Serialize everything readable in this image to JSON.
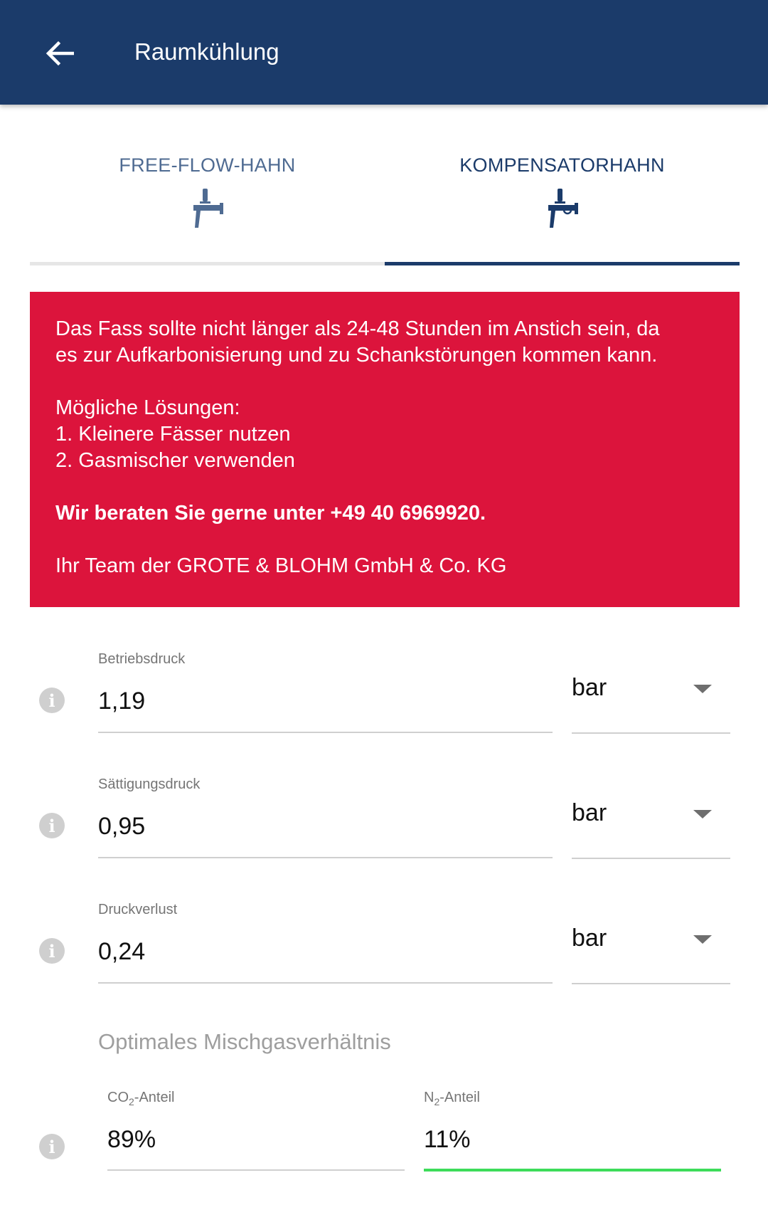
{
  "appbar": {
    "title": "Raumkühlung",
    "back_icon": "arrow-left-icon"
  },
  "tabs": [
    {
      "label": "FREE-FLOW-HAHN",
      "icon": "free-flow-tap-icon",
      "active": false
    },
    {
      "label": "KOMPENSATORHAHN",
      "icon": "compensator-tap-icon",
      "active": true
    }
  ],
  "alert": {
    "line1": "Das Fass sollte nicht länger als 24-48 Stunden im Anstich sein, da",
    "line2": "es zur Aufkarbonisierung und zu Schankstörungen kommen kann.",
    "solutions_title": "Mögliche Lösungen:",
    "solution1": "1. Kleinere Fässer nutzen",
    "solution2": "2. Gasmischer verwenden",
    "contact": "Wir beraten Sie gerne unter +49 40 6969920.",
    "signature": "Ihr Team der GROTE & BLOHM GmbH & Co. KG",
    "background_color": "#dc143c"
  },
  "fields": {
    "betriebsdruck": {
      "label": "Betriebsdruck",
      "value": "1,19",
      "unit": "bar"
    },
    "saettigungsdruck": {
      "label": "Sättigungsdruck",
      "value": "0,95",
      "unit": "bar"
    },
    "druckverlust": {
      "label": "Druckverlust",
      "value": "0,24",
      "unit": "bar"
    }
  },
  "mix": {
    "title": "Optimales Mischgasverhältnis",
    "co2": {
      "label_main": "CO",
      "label_sub": "2",
      "label_suffix": "-Anteil",
      "value": "89%"
    },
    "n2": {
      "label_main": "N",
      "label_sub": "2",
      "label_suffix": "-Anteil",
      "value": "11%"
    }
  },
  "colors": {
    "primary": "#1b3b6a",
    "focus_green": "#3ddc5a",
    "info_gray": "#cfcfcf"
  }
}
